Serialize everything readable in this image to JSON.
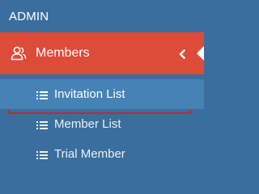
{
  "header": {
    "title": "ADMIN"
  },
  "menu": {
    "section_label": "Members",
    "section_icon": "users-icon",
    "expand_icon": "chevron-left-icon",
    "items": [
      {
        "label": "Invitation List",
        "icon": "list-icon",
        "active": true
      },
      {
        "label": "Member List",
        "icon": "list-icon",
        "active": false
      },
      {
        "label": "Trial Member",
        "icon": "list-icon",
        "active": false
      }
    ]
  },
  "colors": {
    "sidebar_bg": "#3a6e9e",
    "section_bg": "#dd4b39",
    "active_item_bg": "#4582b6",
    "highlight_border": "#c9262c",
    "text": "#ffffff"
  }
}
